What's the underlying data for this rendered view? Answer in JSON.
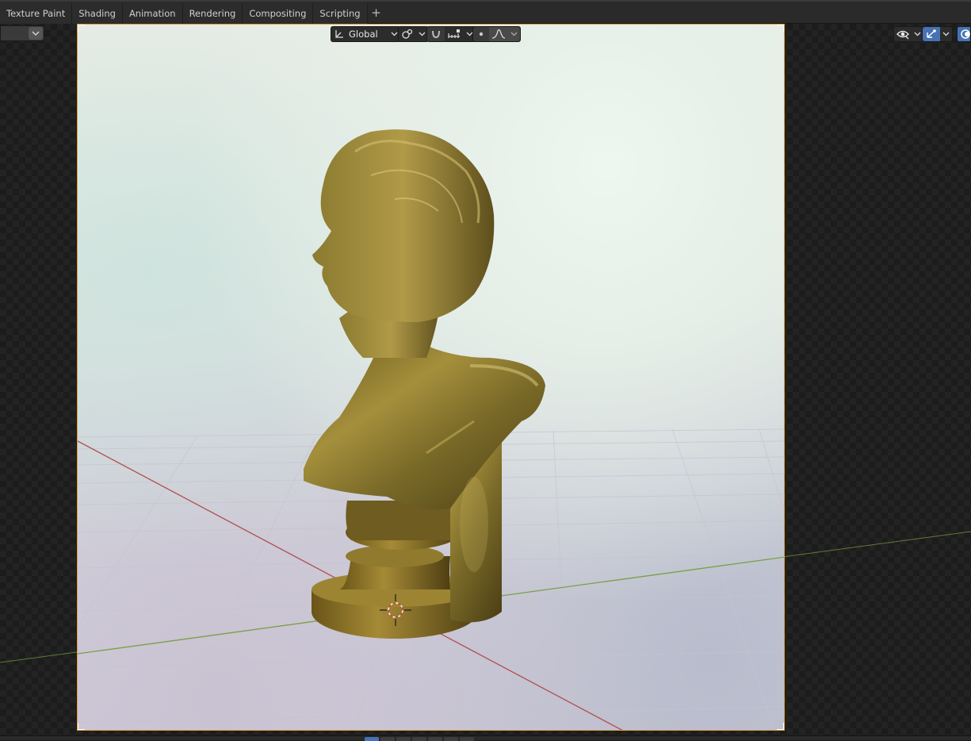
{
  "workspace_tabs": [
    {
      "label": "Texture Paint"
    },
    {
      "label": "Shading"
    },
    {
      "label": "Animation"
    },
    {
      "label": "Rendering"
    },
    {
      "label": "Compositing"
    },
    {
      "label": "Scripting"
    }
  ],
  "add_tab_symbol": "+",
  "viewport_header": {
    "transform_orientation": "Global",
    "icons": {
      "orientation": "transform-orientation-icon",
      "pivot": "pivot-point-icon",
      "snap": "snap-magnet-icon",
      "snap_target": "snap-increment-icon",
      "proportional": "proportional-editing-icon",
      "falloff": "falloff-curve-icon",
      "visibility": "eye-visibility-icon",
      "gizmo": "gizmo-toggle-icon",
      "overlay": "overlay-icon"
    }
  },
  "colors": {
    "accent_blue": "#4772b3",
    "camera_frame": "#e0a040",
    "x_axis": "#c0504d",
    "y_axis": "#7aa046",
    "bust_gold": "#8a7a2e"
  }
}
